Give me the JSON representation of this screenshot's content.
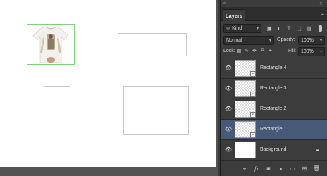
{
  "panel": {
    "tab_label": "Layers",
    "filter": {
      "kind_label": "Kind",
      "icons": [
        "image-filter-icon",
        "adjustment-filter-icon",
        "type-filter-icon",
        "shape-filter-icon",
        "smart-object-filter-icon"
      ]
    },
    "blend_mode": "Normal",
    "opacity_label": "Opacity:",
    "opacity_value": "100%",
    "lock_label": "Lock:",
    "fill_label": "Fill:",
    "fill_value": "100%"
  },
  "layers": [
    {
      "name": "Rectangle 4",
      "visible": true,
      "selected": false
    },
    {
      "name": "Rectangle 3",
      "visible": true,
      "selected": false
    },
    {
      "name": "Rectangle 2",
      "visible": true,
      "selected": false
    },
    {
      "name": "Rectangle 1",
      "visible": true,
      "selected": true
    },
    {
      "name": "Background",
      "visible": true,
      "selected": false,
      "locked": true
    }
  ],
  "footer_icons": [
    "link-icon",
    "fx-icon",
    "mask-icon",
    "adjustment-icon",
    "group-icon",
    "new-layer-icon",
    "delete-icon"
  ],
  "colors": {
    "selected_layer": "#465a78",
    "panel_bg": "#3c3c3c",
    "selection_guide": "#7ed37e"
  }
}
